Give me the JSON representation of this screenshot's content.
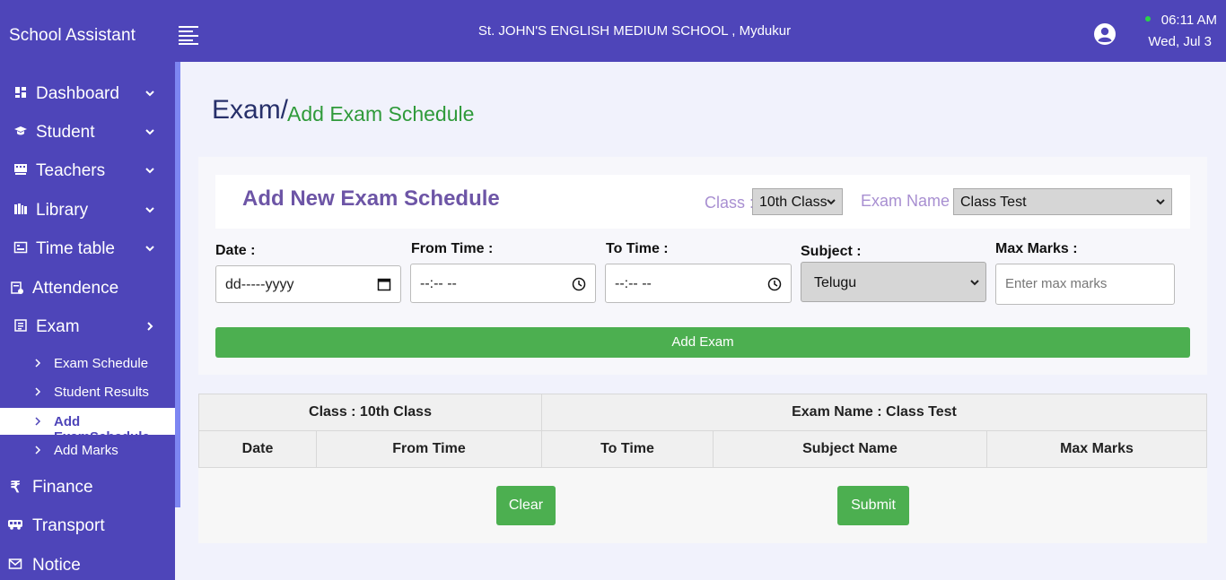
{
  "header": {
    "app_title": "School Assistant",
    "menu_icon": "hamburger-icon",
    "school_name": "St. JOHN'S ENGLISH MEDIUM SCHOOL , Mydukur",
    "user_icon": "user-circle-icon",
    "time": "06:11 AM",
    "date": "Wed, Jul 3",
    "status_color": "#2ad24a"
  },
  "sidebar": {
    "items": [
      {
        "label": "Dashboard",
        "icon": "dashboard-icon"
      },
      {
        "label": "Student",
        "icon": "graduation-cap-icon"
      },
      {
        "label": "Teachers",
        "icon": "chalkboard-icon"
      },
      {
        "label": "Library",
        "icon": "books-icon"
      },
      {
        "label": "Time table",
        "icon": "timetable-icon"
      },
      {
        "label": "Attendence",
        "icon": "attendance-icon"
      },
      {
        "label": "Exam",
        "icon": "exam-icon"
      },
      {
        "label": "Finance",
        "icon": "rupee-icon"
      },
      {
        "label": "Transport",
        "icon": "bus-icon"
      },
      {
        "label": "Notice",
        "icon": "notice-icon"
      }
    ],
    "exam_sub_items": [
      {
        "label": "Exam Schedule"
      },
      {
        "label": "Student Results"
      },
      {
        "label": "Add ExamSchedule"
      },
      {
        "label": "Add Marks"
      }
    ]
  },
  "breadcrumb": {
    "section": "Exam/",
    "page": "Add Exam Schedule"
  },
  "form": {
    "title": "Add New Exam Schedule",
    "class_label": "Class :",
    "class_value": "10th Class",
    "exam_name_label": "Exam Name :",
    "exam_name_value": "Class Test",
    "date_label": "Date :",
    "date_placeholder": "dd-----yyyy",
    "from_time_label": "From Time :",
    "from_time_placeholder": "--:-- --",
    "to_time_label": "To Time :",
    "to_time_placeholder": "--:-- --",
    "subject_label": "Subject :",
    "subject_value": "Telugu",
    "max_marks_label": "Max Marks :",
    "max_marks_placeholder": "Enter max marks",
    "add_button": "Add Exam"
  },
  "table": {
    "class_header": "Class : 10th Class",
    "exam_header": "Exam Name : Class Test",
    "columns": [
      "Date",
      "From Time",
      "To Time",
      "Subject Name",
      "Max Marks"
    ]
  },
  "actions": {
    "clear": "Clear",
    "submit": "Submit"
  },
  "colors": {
    "primary": "#4e45b9",
    "success": "#4caf50",
    "heading": "#6d55a6"
  }
}
